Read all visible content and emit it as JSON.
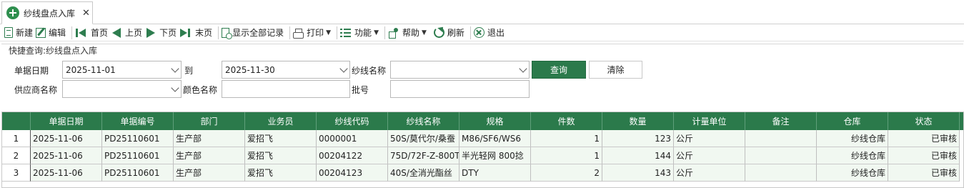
{
  "tab": {
    "title": "纱线盘点入库",
    "close": "✕"
  },
  "toolbar": {
    "new": "新建",
    "edit": "编辑",
    "first": "首页",
    "prev": "上页",
    "next": "下页",
    "last": "末页",
    "show_all": "显示全部记录",
    "print": "打印",
    "function": "功能",
    "help": "帮助",
    "refresh": "刷新",
    "exit": "退出"
  },
  "quick_search": {
    "title": "快捷查询:纱线盘点入库",
    "date_label": "单据日期",
    "date_from": "2025-11-01",
    "to_label": "到",
    "date_to": "2025-11-30",
    "yarn_name_label": "纱线名称",
    "yarn_name_value": "",
    "supplier_label": "供应商名称",
    "supplier_value": "",
    "color_label": "颜色名称",
    "color_value": "",
    "batch_label": "批号",
    "batch_value": "",
    "query_button": "查询",
    "clear_button": "清除"
  },
  "grid": {
    "columns": [
      "单据日期",
      "单据编号",
      "部门",
      "业务员",
      "纱线代码",
      "纱线名称",
      "规格",
      "件数",
      "数量",
      "计量单位",
      "备注",
      "仓库",
      "状态"
    ],
    "rows": [
      {
        "no": "1",
        "date": "2025-11-06",
        "doc_no": "PD25110601",
        "dept": "生产部",
        "staff": "爱招飞",
        "yarn_code": "0000001",
        "yarn_name": "50S/莫代尔/桑蚕",
        "spec": "M86/SF6/WS6",
        "pieces": "1",
        "qty": "123",
        "unit": "公斤",
        "remark": "",
        "warehouse": "纱线仓库",
        "status": "已审核"
      },
      {
        "no": "2",
        "date": "2025-11-06",
        "doc_no": "PD25110601",
        "dept": "生产部",
        "staff": "爱招飞",
        "yarn_code": "00204122",
        "yarn_name": "75D/72F-Z-800T",
        "spec": "半光轻网  800捻",
        "pieces": "1",
        "qty": "144",
        "unit": "公斤",
        "remark": "",
        "warehouse": "纱线仓库",
        "status": "已审核"
      },
      {
        "no": "3",
        "date": "2025-11-06",
        "doc_no": "PD25110601",
        "dept": "生产部",
        "staff": "爱招飞",
        "yarn_code": "00204123",
        "yarn_name": "40S/全消光酯丝",
        "spec": "DTY",
        "pieces": "2",
        "qty": "143",
        "unit": "公斤",
        "remark": "",
        "warehouse": "纱线仓库",
        "status": "已审核"
      }
    ]
  },
  "colors": {
    "accent": "#2b7a4b",
    "row_bg": "#f1f8f1"
  },
  "icons": [
    "app-logo-icon",
    "new-icon",
    "edit-icon",
    "first-page-icon",
    "prev-page-icon",
    "next-page-icon",
    "last-page-icon",
    "show-all-icon",
    "print-icon",
    "function-icon",
    "help-icon",
    "refresh-icon",
    "exit-icon"
  ]
}
